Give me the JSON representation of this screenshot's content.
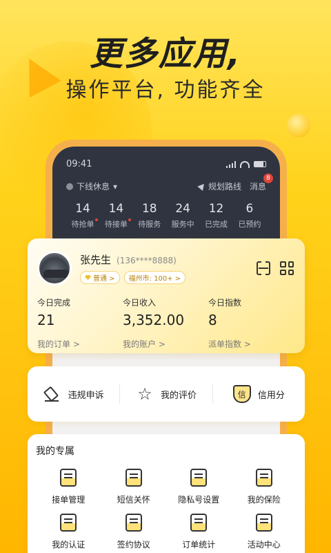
{
  "hero": {
    "title": "更多应用,",
    "subtitle": "操作平台, 功能齐全"
  },
  "phone": {
    "time": "09:41",
    "mode_label": "下线休息",
    "route_label": "规划路线",
    "msg_label": "消息",
    "msg_badge": "8",
    "stats": [
      {
        "value": "14",
        "label": "待抢单"
      },
      {
        "value": "14",
        "label": "待接单"
      },
      {
        "value": "18",
        "label": "待服务"
      },
      {
        "value": "24",
        "label": "服务中"
      },
      {
        "value": "12",
        "label": "已完成"
      },
      {
        "value": "6",
        "label": "已预约"
      }
    ]
  },
  "profile": {
    "name": "张先生",
    "phone": "(136****8888)",
    "level_tag": "普通 >",
    "city_tag": "福州市: 100+ >",
    "metrics": [
      {
        "label": "今日完成",
        "value": "21",
        "link": "我的订单 >"
      },
      {
        "label": "今日收入",
        "value": "3,352.00",
        "link": "我的账户 >"
      },
      {
        "label": "今日指数",
        "value": "8",
        "link": "派单指数 >"
      }
    ]
  },
  "shortcuts": {
    "items": [
      "违规申诉",
      "我的评价",
      "信用分"
    ],
    "credit_icon_char": "信"
  },
  "exclusive": {
    "title": "我的专属",
    "items": [
      "接单管理",
      "短信关怀",
      "隐私号设置",
      "我的保险",
      "我的认证",
      "签约协议",
      "订单统计",
      "活动中心"
    ]
  },
  "colors": {
    "brand_yellow": "#ffd21a",
    "dark_panel": "#2f3440",
    "badge_red": "#e0453a"
  }
}
